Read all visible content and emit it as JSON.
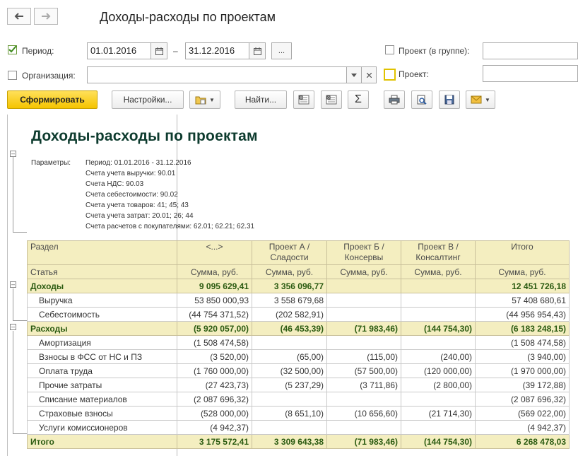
{
  "window": {
    "title": "Доходы-расходы по проектам"
  },
  "form": {
    "period_label": "Период:",
    "period_checked": true,
    "date_from": "01.01.2016",
    "date_sep": "–",
    "date_to": "31.12.2016",
    "period_more": "...",
    "org_label": "Организация:",
    "org_value": "",
    "project_group_label": "Проект (в группе):",
    "project_group_value": "",
    "project_label": "Проект:",
    "project_value": ""
  },
  "toolbar": {
    "generate_label": "Сформировать",
    "settings_label": "Настройки...",
    "find_label": "Найти...",
    "sum_symbol": "Σ"
  },
  "report": {
    "title": "Доходы-расходы по проектам",
    "params_label": "Параметры:",
    "params": [
      "Период: 01.01.2016 - 31.12.2016",
      "Счета учета выручки: 90.01",
      "Счета НДС: 90.03",
      "Счета себестоимости: 90.02",
      "Счета учета товаров: 41; 45; 43",
      "Счета учета затрат: 20.01; 26; 44",
      "Счета расчетов с покупателями: 62.01; 62.21; 62.31"
    ],
    "header1": [
      "Раздел",
      "<...>",
      "Проект А /\nСладости",
      "Проект Б /\nКонсервы",
      "Проект В /\nКонсалтинг",
      "Итого"
    ],
    "header2": [
      "Статья",
      "Сумма, руб.",
      "Сумма, руб.",
      "Сумма, руб.",
      "Сумма, руб.",
      "Сумма, руб."
    ],
    "rows": [
      {
        "type": "group",
        "cells": [
          "Доходы",
          "9 095 629,41",
          "3 356 096,77",
          "",
          "",
          "12 451 726,18"
        ]
      },
      {
        "type": "item",
        "cells": [
          "Выручка",
          "53 850 000,93",
          "3 558 679,68",
          "",
          "",
          "57 408 680,61"
        ]
      },
      {
        "type": "item",
        "cells": [
          "Себестоимость",
          "(44 754 371,52)",
          "(202 582,91)",
          "",
          "",
          "(44 956 954,43)"
        ]
      },
      {
        "type": "group",
        "cells": [
          "Расходы",
          "(5 920 057,00)",
          "(46 453,39)",
          "(71 983,46)",
          "(144 754,30)",
          "(6 183 248,15)"
        ]
      },
      {
        "type": "item",
        "cells": [
          "Амортизация",
          "(1 508 474,58)",
          "",
          "",
          "",
          "(1 508 474,58)"
        ]
      },
      {
        "type": "item",
        "cells": [
          "Взносы в ФСС от НС и ПЗ",
          "(3 520,00)",
          "(65,00)",
          "(115,00)",
          "(240,00)",
          "(3 940,00)"
        ]
      },
      {
        "type": "item",
        "cells": [
          "Оплата труда",
          "(1 760 000,00)",
          "(32 500,00)",
          "(57 500,00)",
          "(120 000,00)",
          "(1 970 000,00)"
        ]
      },
      {
        "type": "item",
        "cells": [
          "Прочие затраты",
          "(27 423,73)",
          "(5 237,29)",
          "(3 711,86)",
          "(2 800,00)",
          "(39 172,88)"
        ]
      },
      {
        "type": "item",
        "cells": [
          "Списание материалов",
          "(2 087 696,32)",
          "",
          "",
          "",
          "(2 087 696,32)"
        ]
      },
      {
        "type": "item",
        "cells": [
          "Страховые взносы",
          "(528 000,00)",
          "(8 651,10)",
          "(10 656,60)",
          "(21 714,30)",
          "(569 022,00)"
        ]
      },
      {
        "type": "item",
        "cells": [
          "Услуги комиссионеров",
          "(4 942,37)",
          "",
          "",
          "",
          "(4 942,37)"
        ]
      },
      {
        "type": "total",
        "cells": [
          "Итого",
          "3 175 572,41",
          "3 309 643,38",
          "(71 983,46)",
          "(144 754,30)",
          "6 268 478,03"
        ]
      }
    ]
  },
  "colors": {
    "header_bg": "#f4eec0",
    "group_text": "#2a5a10",
    "title_text": "#0d3b2e",
    "primary_button": "#f5c400"
  }
}
